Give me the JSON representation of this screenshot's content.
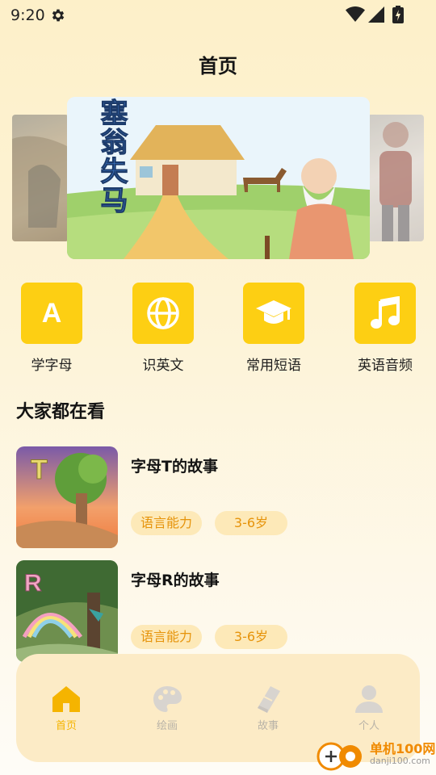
{
  "status": {
    "time": "9:20"
  },
  "header": {
    "title": "首页"
  },
  "banner": {
    "story_title": "塞翁失马"
  },
  "categories": [
    {
      "label": "学字母",
      "icon": "letter-a-icon",
      "glyph": "A"
    },
    {
      "label": "识英文",
      "icon": "globe-icon"
    },
    {
      "label": "常用短语",
      "icon": "graduation-cap-icon"
    },
    {
      "label": "英语音频",
      "icon": "music-note-icon"
    }
  ],
  "section": {
    "title": "大家都在看"
  },
  "stories": [
    {
      "title": "字母T的故事",
      "tags": [
        "语言能力",
        "3-6岁"
      ],
      "thumb_letter": "T"
    },
    {
      "title": "字母R的故事",
      "tags": [
        "语言能力",
        "3-6岁"
      ],
      "thumb_letter": "R"
    }
  ],
  "nav": {
    "items": [
      {
        "label": "首页",
        "icon": "home-icon",
        "active": true
      },
      {
        "label": "绘画",
        "icon": "palette-icon",
        "active": false
      },
      {
        "label": "故事",
        "icon": "book-icon",
        "active": false
      },
      {
        "label": "个人",
        "icon": "person-icon",
        "active": false
      }
    ]
  },
  "watermark": {
    "name": "单机100网",
    "url": "danji100.com"
  },
  "colors": {
    "accent": "#fdcf13",
    "tag_bg": "#fde9b8",
    "tag_text": "#e6930a",
    "nav_bg": "#fcebc6",
    "active": "#f5b400"
  }
}
